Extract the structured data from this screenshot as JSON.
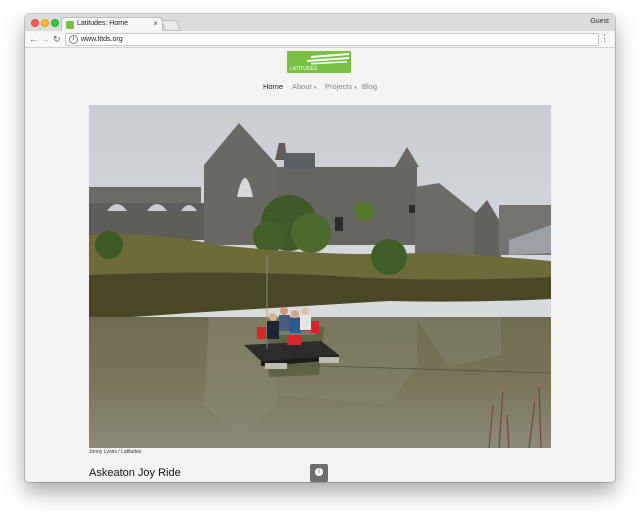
{
  "browser": {
    "tab_title": "Latitudes: Home",
    "tab_close": "×",
    "profile": "Guest",
    "url": "www.lttds.org",
    "info_glyph": "i",
    "back_glyph": "←",
    "forward_glyph": "→",
    "reload_glyph": "↻",
    "menu_glyph": "⋮"
  },
  "site": {
    "logo_text": "LATITUDES",
    "brand_color": "#79c143"
  },
  "nav": {
    "items": [
      {
        "label": "Home",
        "active": true
      },
      {
        "label": "About",
        "caret": "▾"
      },
      {
        "label": "Projects",
        "caret": "▾"
      },
      {
        "label": "Blog"
      }
    ]
  },
  "hero": {
    "credit": "Jonny Lyons / Latitudes"
  },
  "post": {
    "title": "Askeaton Joy Ride",
    "info_glyph": "i"
  }
}
